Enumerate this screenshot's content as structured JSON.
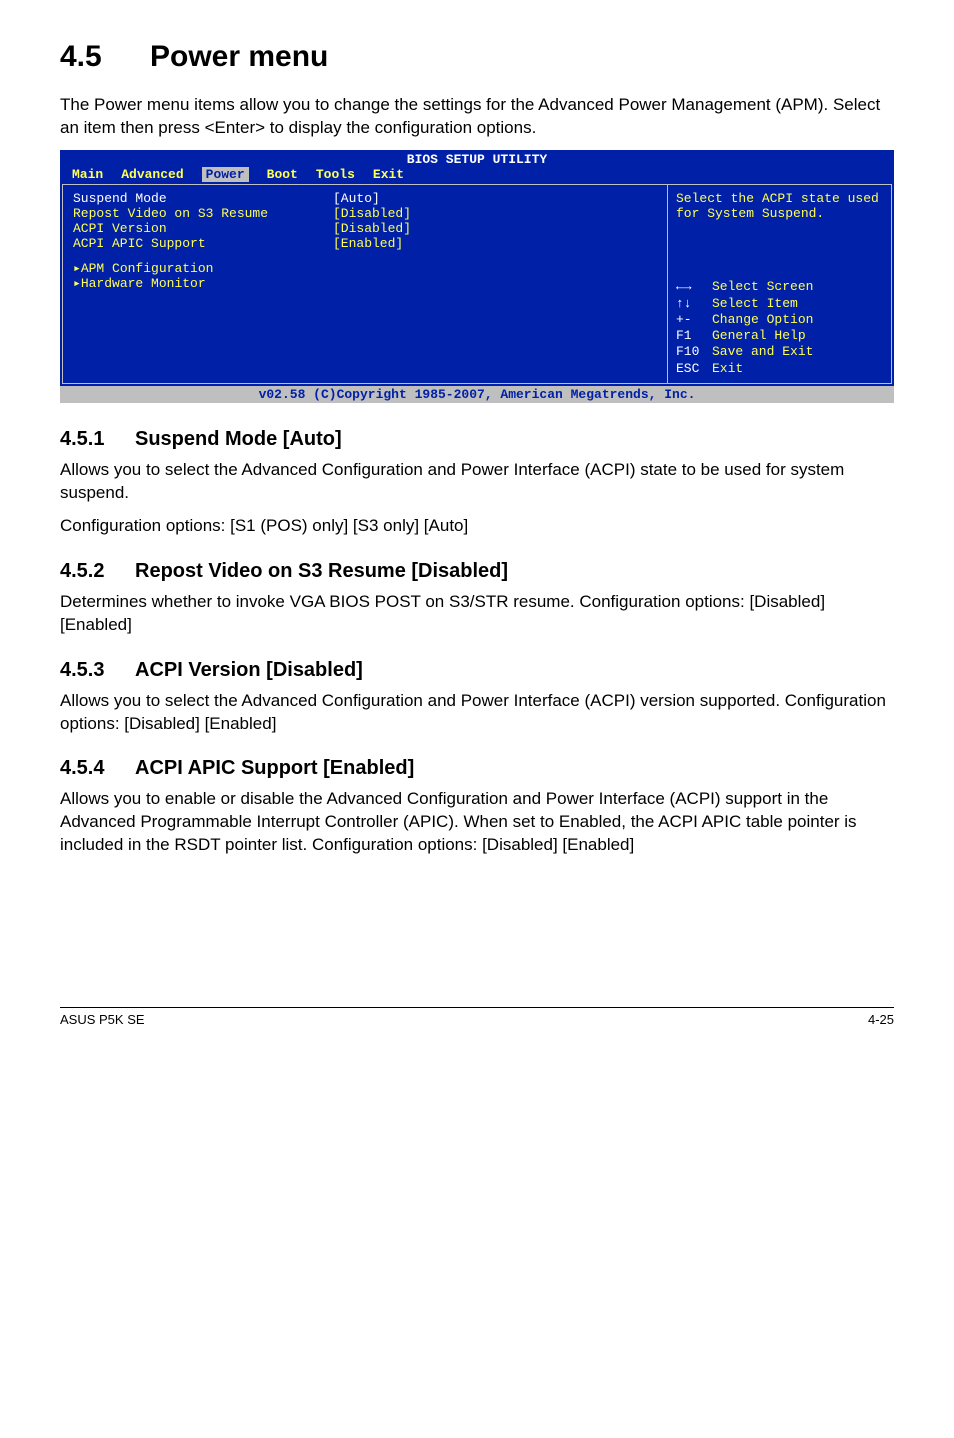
{
  "section": {
    "number": "4.5",
    "title": "Power menu"
  },
  "intro": "The Power menu items allow you to change the settings for the Advanced Power Management (APM). Select an item then press <Enter> to display the configuration options.",
  "bios": {
    "title": "BIOS SETUP UTILITY",
    "tabs": [
      "Main",
      "Advanced",
      "Power",
      "Boot",
      "Tools",
      "Exit"
    ],
    "active_tab": "Power",
    "rows": [
      {
        "label": "Suspend Mode",
        "value": "[Auto]",
        "highlight": true
      },
      {
        "label": "Repost Video on S3 Resume",
        "value": "[Disabled]"
      },
      {
        "label": "ACPI Version",
        "value": "[Disabled]"
      },
      {
        "label": "ACPI APIC Support",
        "value": "[Enabled]"
      }
    ],
    "submenus": [
      "APM Configuration",
      "Hardware Monitor"
    ],
    "help_top": "Select the ACPI state used for System Suspend.",
    "keys": [
      {
        "k": "←→",
        "d": "Select Screen"
      },
      {
        "k": "↑↓",
        "d": "Select Item"
      },
      {
        "k": "+-",
        "d": "Change Option"
      },
      {
        "k": "F1",
        "d": "General Help"
      },
      {
        "k": "F10",
        "d": "Save and Exit"
      },
      {
        "k": "ESC",
        "d": "Exit"
      }
    ],
    "footer": "v02.58 (C)Copyright 1985-2007, American Megatrends, Inc."
  },
  "subs": [
    {
      "num": "4.5.1",
      "title": "Suspend Mode [Auto]",
      "paras": [
        "Allows you to select the Advanced Configuration and Power Interface (ACPI) state to be used for system suspend.",
        "Configuration options: [S1 (POS) only] [S3 only] [Auto]"
      ]
    },
    {
      "num": "4.5.2",
      "title": "Repost Video on S3 Resume [Disabled]",
      "paras": [
        "Determines whether to invoke VGA BIOS POST on S3/STR resume. Configuration options: [Disabled] [Enabled]"
      ]
    },
    {
      "num": "4.5.3",
      "title": "ACPI Version [Disabled]",
      "paras": [
        "Allows you to select the Advanced Configuration and Power Interface (ACPI) version supported. Configuration options: [Disabled] [Enabled]"
      ]
    },
    {
      "num": "4.5.4",
      "title": "ACPI APIC Support [Enabled]",
      "paras": [
        "Allows you to enable or disable the Advanced Configuration and Power Interface (ACPI) support in the Advanced Programmable Interrupt Controller (APIC). When set to Enabled, the ACPI APIC table pointer is included in the RSDT pointer list. Configuration options: [Disabled] [Enabled]"
      ]
    }
  ],
  "footer": {
    "left": "ASUS P5K SE",
    "right": "4-25"
  }
}
